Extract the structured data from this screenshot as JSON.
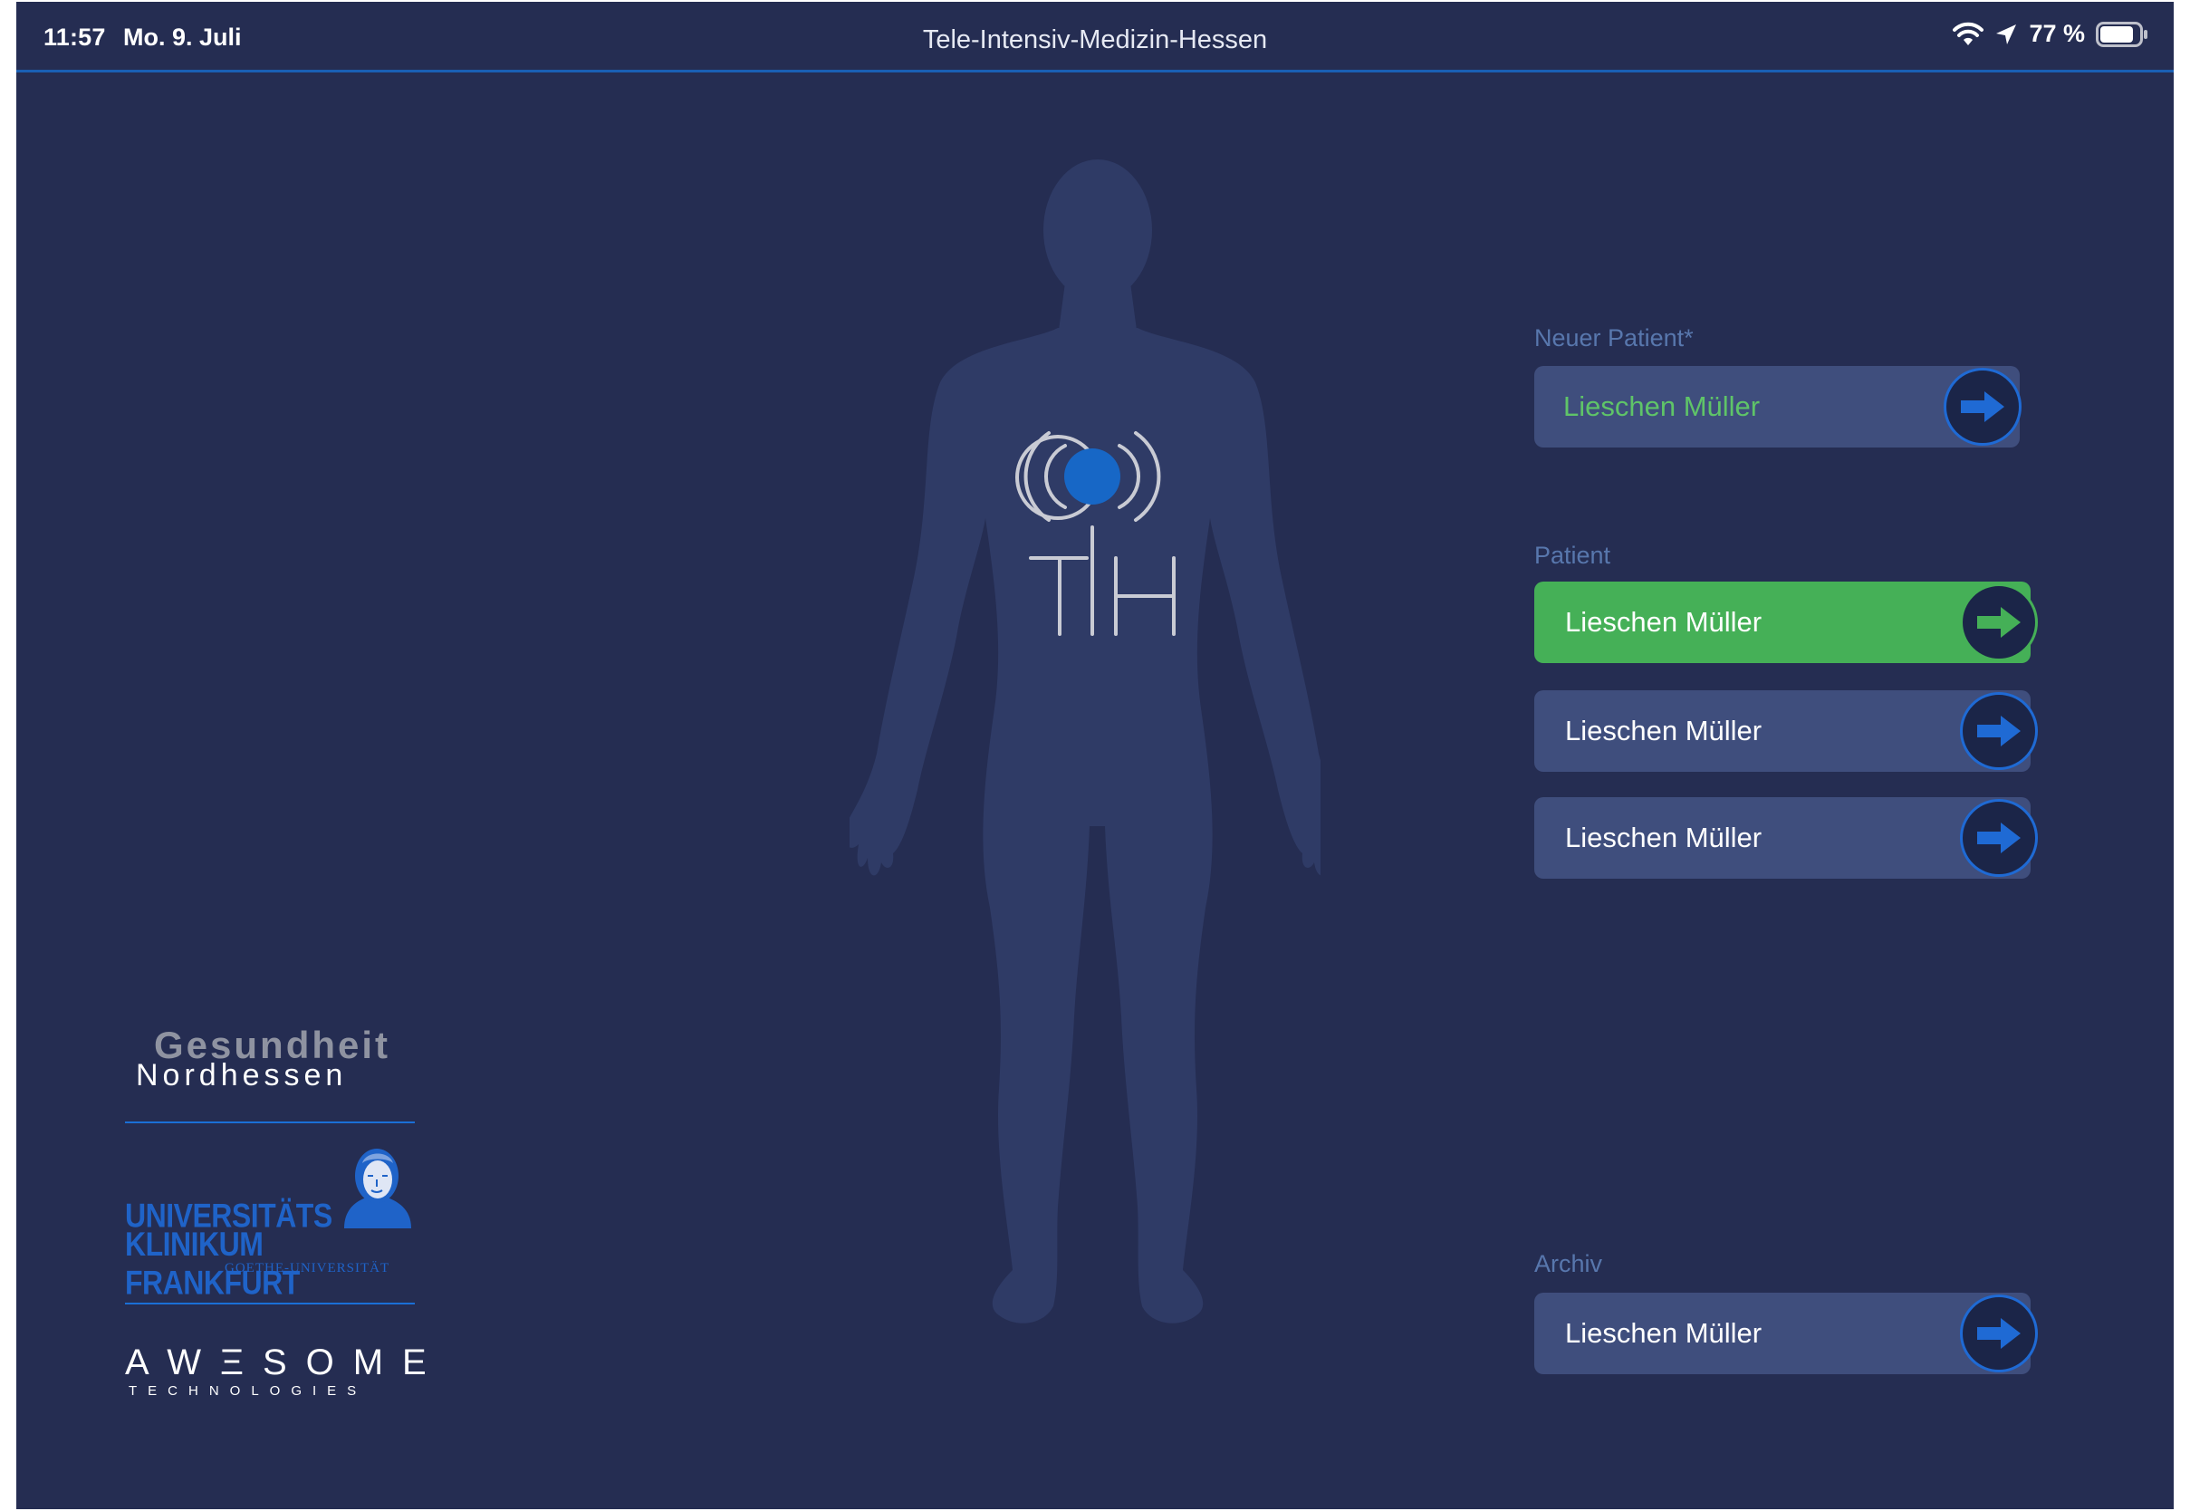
{
  "status_bar": {
    "time": "11:57",
    "date": "Mo. 9. Juli",
    "title": "Tele-Intensiv-Medizin-Hessen",
    "battery": "77 %"
  },
  "center_logo": {
    "letters": "TIH"
  },
  "logos": {
    "gesundheit": "Gesundheit",
    "nordhessen": "Nordhessen",
    "uni_line1": "UNIVERSITÄTS",
    "uni_line2": "KLINIKUM FRANKFURT",
    "uni_line3": "GOETHE-UNIVERSITÄT",
    "awesome": "AWΞSOME",
    "technologies": "TECHNOLOGIES"
  },
  "new_patient": {
    "label": "Neuer Patient*",
    "name": "Lieschen Müller"
  },
  "patients": {
    "label": "Patient",
    "items": [
      {
        "name": "Lieschen Müller"
      },
      {
        "name": "Lieschen Müller"
      },
      {
        "name": "Lieschen Müller"
      }
    ]
  },
  "archive": {
    "label": "Archiv",
    "name": "Lieschen Müller"
  },
  "colors": {
    "background": "#252d52",
    "accent_blue": "#1f6ad4",
    "active_green": "#45b057",
    "button": "#3f4e7d"
  }
}
